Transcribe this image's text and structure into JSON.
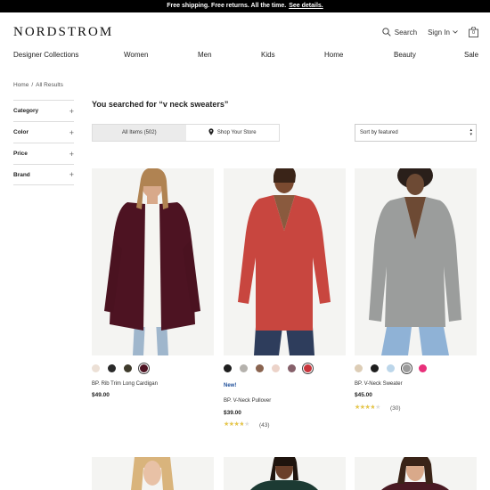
{
  "banner": {
    "text": "Free shipping. Free returns. All the time.",
    "link": "See details."
  },
  "header": {
    "logo": "NORDSTROM",
    "search_label": "Search",
    "signin_label": "Sign In",
    "icons": [
      "search-icon",
      "chevron-down-icon",
      "bag-icon"
    ],
    "bag_count": "0"
  },
  "nav": [
    "Designer Collections",
    "Women",
    "Men",
    "Kids",
    "Home",
    "Beauty",
    "Sale"
  ],
  "breadcrumb": [
    "Home",
    "All Results"
  ],
  "filters": [
    "Category",
    "Color",
    "Price",
    "Brand"
  ],
  "results_heading": "You searched for “v neck sweaters”",
  "toggle": {
    "all_items": "All Items (502)",
    "shop_store": "Shop Your Store"
  },
  "sort": {
    "selected": "Sort by featured"
  },
  "products": [
    {
      "name": "BP. Rib Trim Long Cardigan",
      "price": "$49.00",
      "swatches": [
        "#ece0d6",
        "#2a2a2a",
        "#3f3b2c",
        "#4d1322"
      ],
      "selected_swatch": 3
    },
    {
      "badge": "New!",
      "name": "BP. V-Neck Pullover",
      "price": "$39.00",
      "swatches": [
        "#1e1e1e",
        "#b5b2ad",
        "#8a6450",
        "#ecd3c9",
        "#86606a",
        "#c8343a"
      ],
      "selected_swatch": 5,
      "rating": 3.5,
      "review_count": "(43)"
    },
    {
      "name": "BP. V-Neck Sweater",
      "price": "$45.00",
      "swatches": [
        "#ddcdb6",
        "#1e1e1e",
        "#bcd6ea",
        "#9b9b9b",
        "#e8307a"
      ],
      "selected_swatch": 3,
      "rating": 3.5,
      "review_count": "(30)"
    }
  ]
}
